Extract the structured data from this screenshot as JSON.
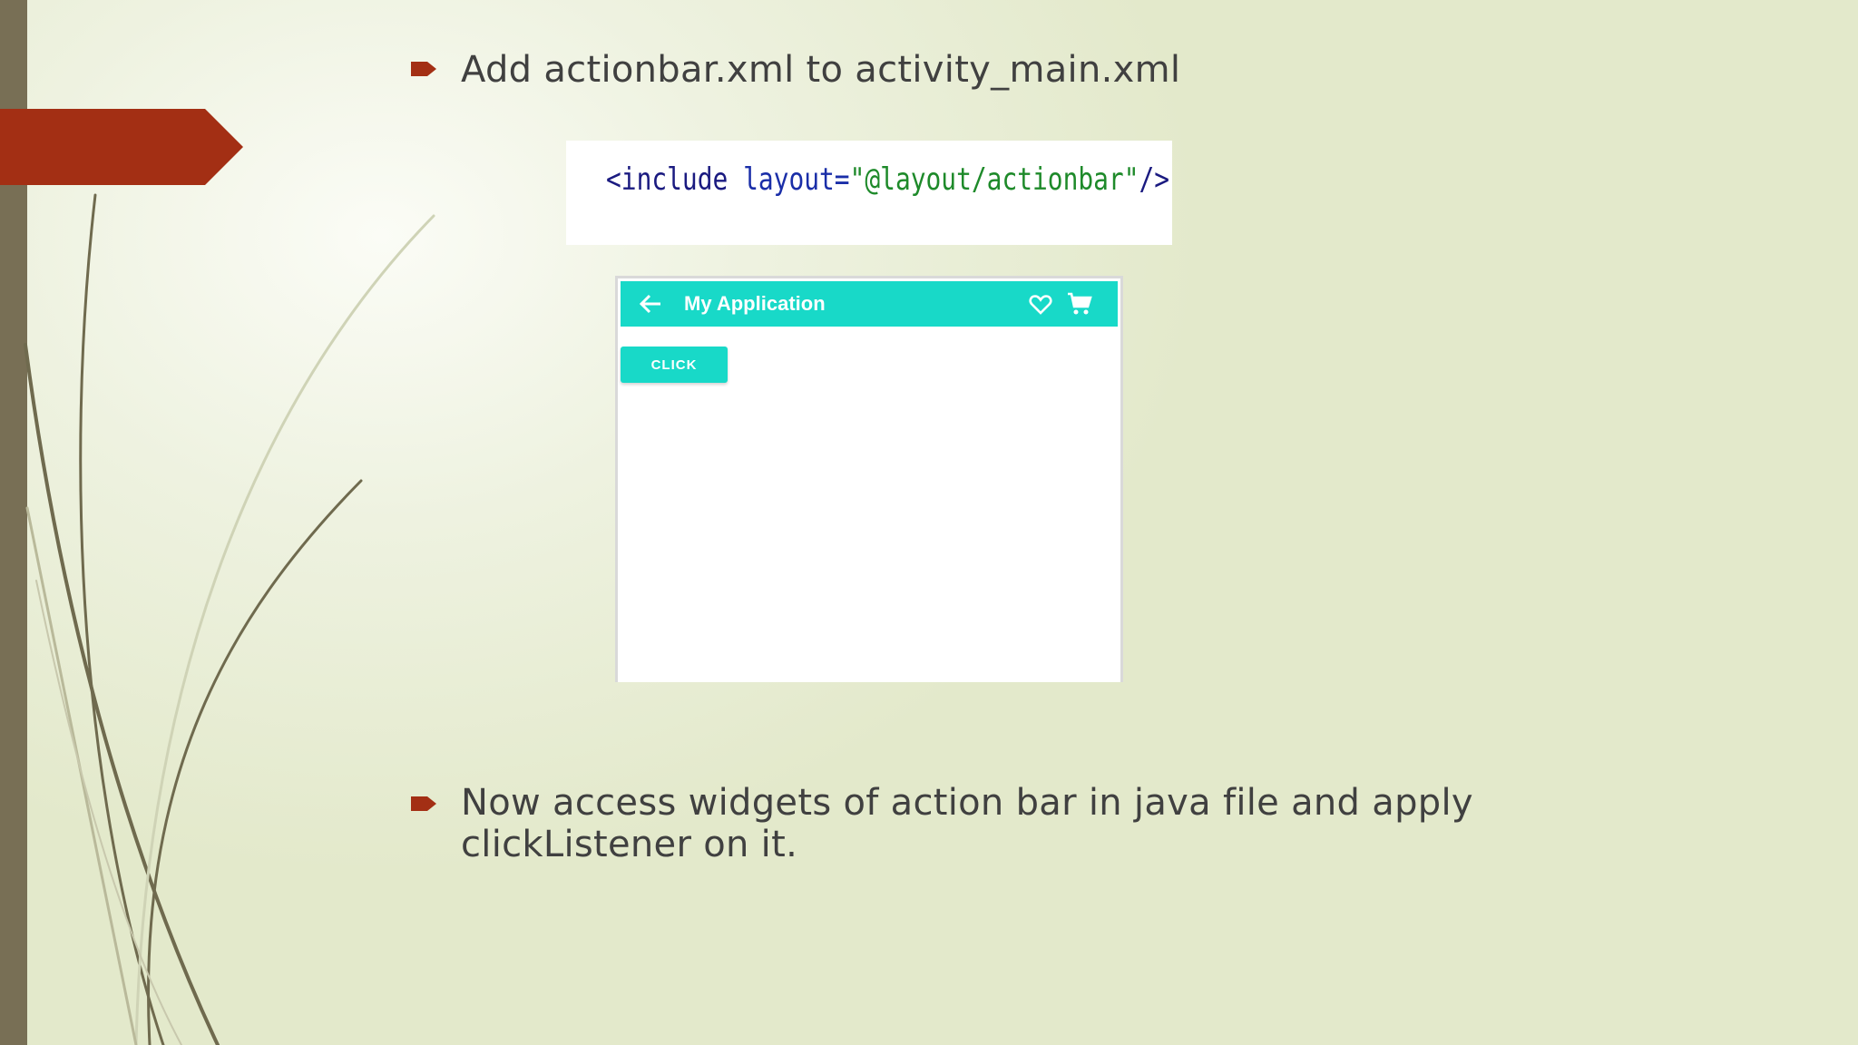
{
  "slide": {
    "bullets": [
      {
        "icon": "arrow-bullet-icon",
        "text": "Add actionbar.xml to activity_main.xml"
      },
      {
        "icon": "arrow-bullet-icon",
        "text": "Now access widgets of action bar in java file and apply clickListener on it."
      }
    ],
    "code": {
      "tag_open": "<include",
      "attr": "layout=",
      "value": "\"@layout/actionbar\"",
      "tag_close": "/>"
    },
    "phone": {
      "app_title": "My Application",
      "button_label": "CLICK",
      "icons": [
        "back-arrow-icon",
        "heart-icon",
        "cart-icon"
      ]
    }
  },
  "colors": {
    "accent_red": "#a32f14",
    "bar_brown": "#786f55",
    "app_teal": "#18d9c8",
    "text": "#404040"
  }
}
